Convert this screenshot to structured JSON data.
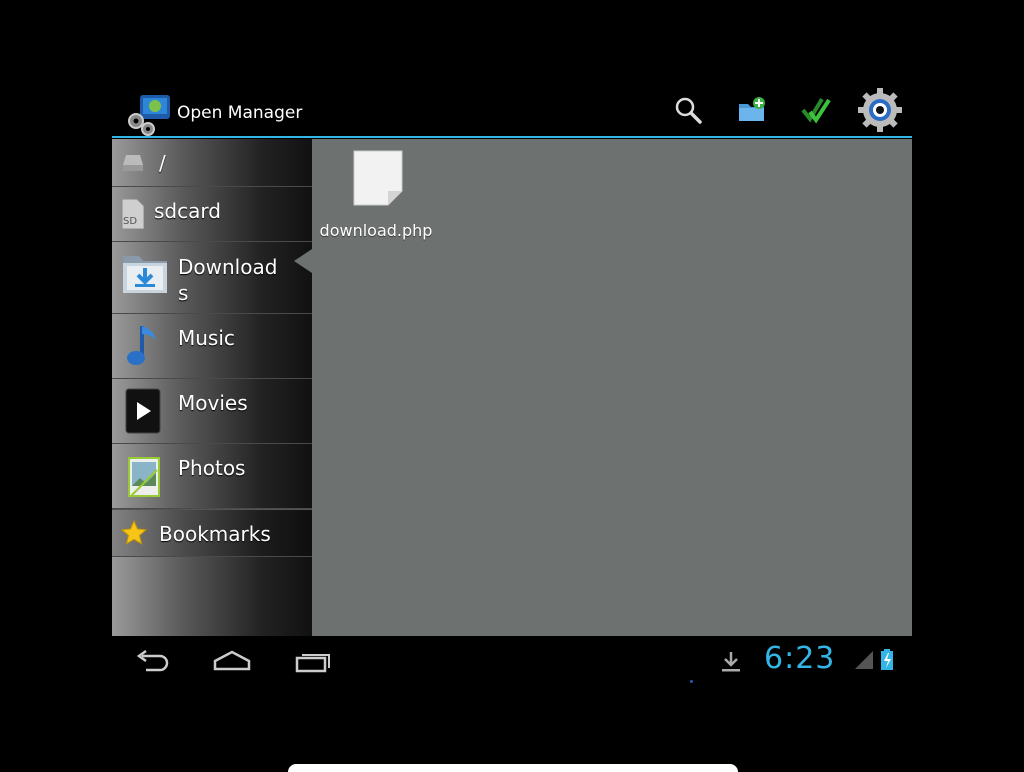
{
  "action_bar": {
    "title": "Open Manager",
    "actions": [
      {
        "name": "search",
        "icon": "search-icon"
      },
      {
        "name": "new-folder",
        "icon": "new-folder-icon"
      },
      {
        "name": "multi-select",
        "icon": "checkmarks-icon"
      },
      {
        "name": "settings",
        "icon": "gear-icon"
      }
    ]
  },
  "sidebar": {
    "items": [
      {
        "label": "/",
        "icon": "root-drive-icon"
      },
      {
        "label": "sdcard",
        "icon": "sdcard-icon"
      },
      {
        "label": "Download\ns",
        "icon": "download-folder-icon",
        "selected": true
      },
      {
        "label": "Music",
        "icon": "music-note-icon"
      },
      {
        "label": "Movies",
        "icon": "play-icon"
      },
      {
        "label": "Photos",
        "icon": "photo-icon"
      },
      {
        "label": "Bookmarks",
        "icon": "star-icon"
      }
    ]
  },
  "content": {
    "files": [
      {
        "name": "download.php",
        "icon": "document-icon"
      }
    ]
  },
  "system_bar": {
    "time": "6:23",
    "icons": [
      "back-icon",
      "home-icon",
      "recents-icon",
      "download-status-icon",
      "signal-icon",
      "battery-charging-icon"
    ]
  },
  "colors": {
    "accent": "#33b5e5",
    "content_bg": "#6d7170"
  }
}
